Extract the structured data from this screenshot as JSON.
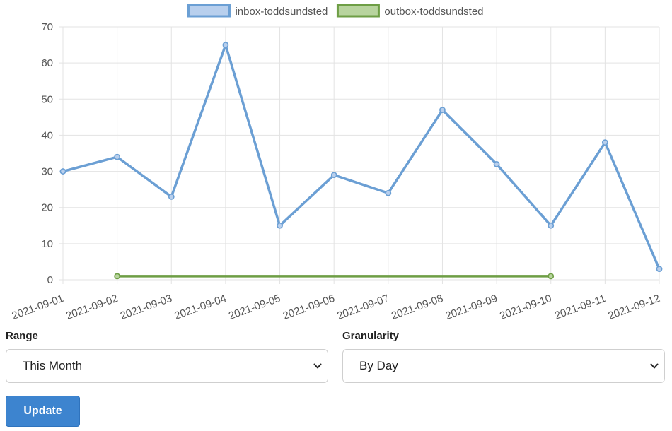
{
  "chart_data": {
    "type": "line",
    "x": [
      "2021-09-01",
      "2021-09-02",
      "2021-09-03",
      "2021-09-04",
      "2021-09-05",
      "2021-09-06",
      "2021-09-07",
      "2021-09-08",
      "2021-09-09",
      "2021-09-10",
      "2021-09-11",
      "2021-09-12"
    ],
    "series": [
      {
        "name": "inbox-toddsundsted",
        "color": "#6b9fd4",
        "fill": "#b8cfed",
        "values": [
          30,
          34,
          23,
          65,
          15,
          29,
          24,
          47,
          32,
          15,
          38,
          3
        ]
      },
      {
        "name": "outbox-toddsundsted",
        "color": "#6e9e45",
        "fill": "#b8d49e",
        "values": [
          null,
          1,
          null,
          null,
          null,
          null,
          null,
          null,
          null,
          1,
          null,
          null
        ],
        "connect_gaps": true
      }
    ],
    "ylim": [
      0,
      70
    ],
    "yticks": [
      0,
      10,
      20,
      30,
      40,
      50,
      60,
      70
    ],
    "grid": true,
    "legend": "top-center",
    "title": "",
    "xlabel": "",
    "ylabel": ""
  },
  "controls": {
    "range": {
      "label": "Range",
      "value": "This Month"
    },
    "granularity": {
      "label": "Granularity",
      "value": "By Day"
    },
    "update_label": "Update"
  }
}
